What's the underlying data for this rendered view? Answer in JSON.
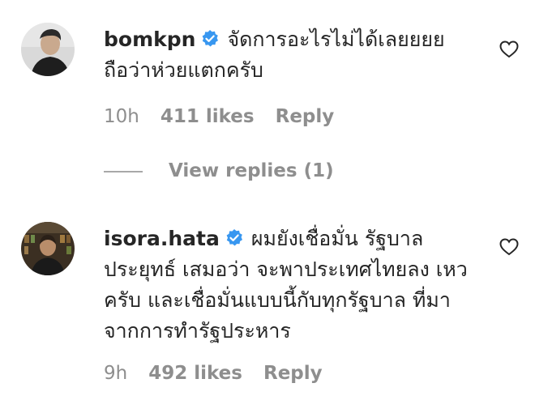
{
  "comments": [
    {
      "username": "bomkpn",
      "text": "จัดการอะไรไม่ได้เลยยยย ถือว่าห่วยแตกครับ",
      "time": "10h",
      "likes": "411 likes",
      "reply_label": "Reply",
      "verified": true
    },
    {
      "username": "isora.hata",
      "text": "ผมยังเชื่อมั่น รัฐบาล ประยุทธ์ เสมอว่า จะพาประเทศไทยลง เหว ครับ และเชื่อมั่นแบบนี้กับทุกรัฐบาล ที่มาจากการทำรัฐประหาร",
      "time": "9h",
      "likes": "492 likes",
      "reply_label": "Reply",
      "verified": true
    }
  ],
  "view_replies": {
    "label": "View replies (1)"
  },
  "icons": {
    "verified": "verified-badge-icon",
    "heart": "heart-outline-icon",
    "verified_color": "#3897f0"
  }
}
